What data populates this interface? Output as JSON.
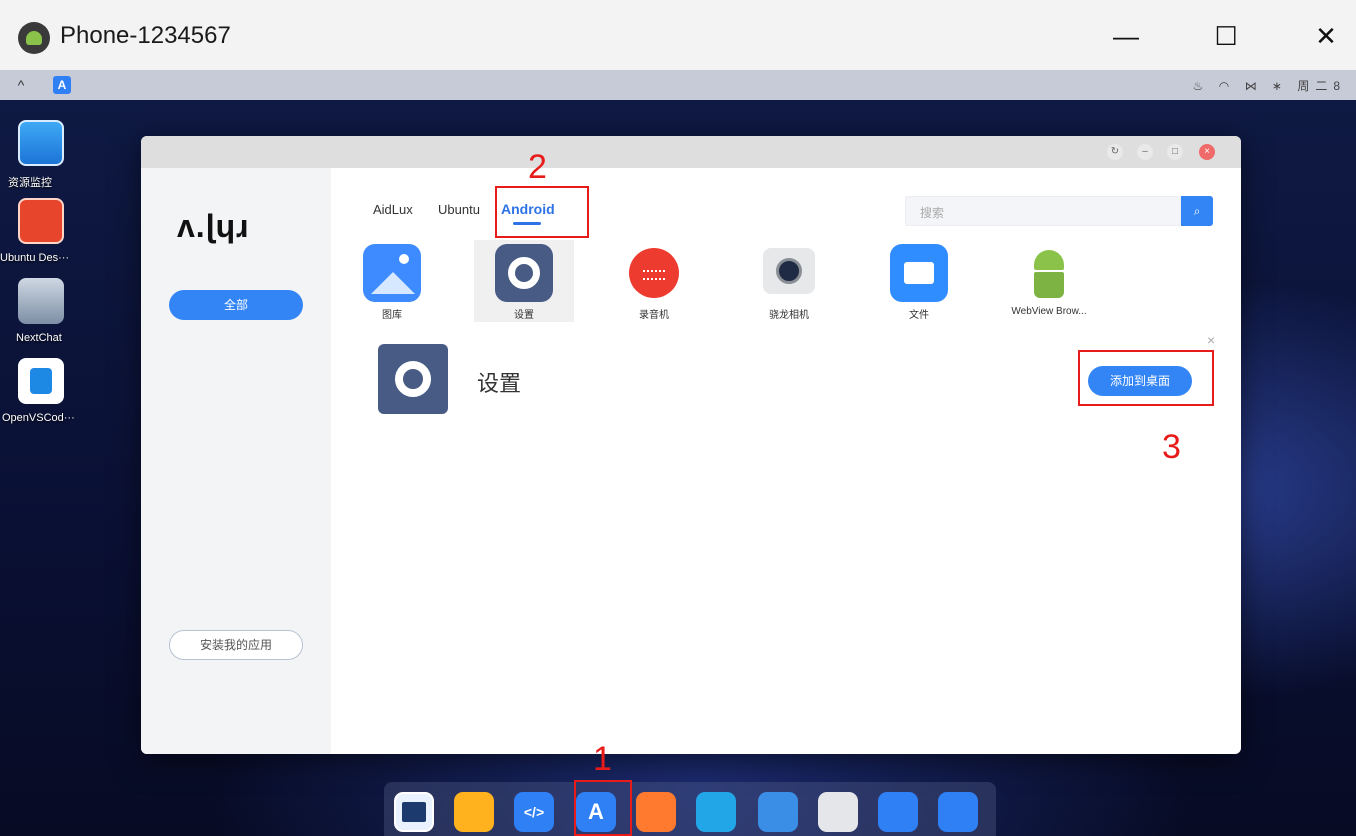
{
  "window": {
    "title": "Phone-1234567",
    "minimize": "—",
    "maximize": "☐",
    "close": "✕"
  },
  "desktop": {
    "icons": [
      {
        "label": "资源监控",
        "icon": "monitor-chart-icon"
      },
      {
        "label": "Ubuntu Des···",
        "icon": "ubuntu-desktop-icon"
      },
      {
        "label": "NextChat",
        "icon": "nextchat-icon"
      },
      {
        "label": "OpenVSCod···",
        "icon": "vscode-icon"
      }
    ],
    "tray_text": "周二8",
    "topbar_app_letter": "A"
  },
  "app_window": {
    "logo": "ʌ.ɭɥɹ",
    "sidebar": {
      "all_label": "全部",
      "install_label": "安装我的应用"
    },
    "tabs": [
      {
        "label": "AidLux"
      },
      {
        "label": "Ubuntu"
      },
      {
        "label": "Android",
        "active": true
      }
    ],
    "search": {
      "placeholder": "搜索",
      "icon": "search-icon"
    },
    "apps": [
      {
        "label": "图库",
        "icon": "gallery-icon",
        "color": "#3d8bff"
      },
      {
        "label": "设置",
        "icon": "settings-gear-icon",
        "color": "#475b84",
        "selected": true
      },
      {
        "label": "录音机",
        "icon": "recorder-icon",
        "color": "#ee3b2f"
      },
      {
        "label": "骁龙相机",
        "icon": "camera-icon",
        "color": "#8a8f96"
      },
      {
        "label": "文件",
        "icon": "folder-icon",
        "color": "#2f8dff"
      },
      {
        "label": "WebView Brow...",
        "icon": "android-robot-icon",
        "color": "#7cb342"
      }
    ],
    "detail": {
      "name": "设置",
      "add_label": "添加到桌面",
      "close": "×"
    }
  },
  "annotations": {
    "step1": "1",
    "step2": "2",
    "step3": "3",
    "color": "#e81b1b"
  }
}
